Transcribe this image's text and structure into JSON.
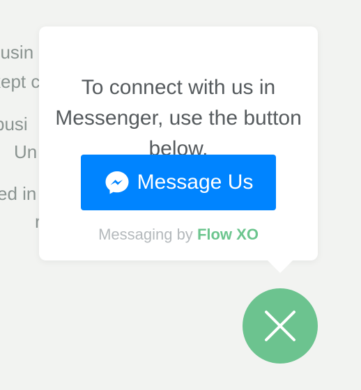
{
  "background_text": [
    {
      "text": "busin"
    },
    {
      "text": "kept c"
    },
    {
      "text": "busi"
    },
    {
      "text": "Un"
    },
    {
      "text": "ed in"
    },
    {
      "text": "r"
    }
  ],
  "popup": {
    "message": "To connect with us in Messenger, use the button below.",
    "button": {
      "label": "Message Us",
      "icon": "messenger-icon",
      "color": "#0084ff"
    },
    "attribution": {
      "prefix": "Messaging by",
      "brand": "Flow XO",
      "brand_color": "#6cc58e"
    }
  },
  "fab": {
    "icon": "close-icon",
    "color": "#6cc38f"
  }
}
